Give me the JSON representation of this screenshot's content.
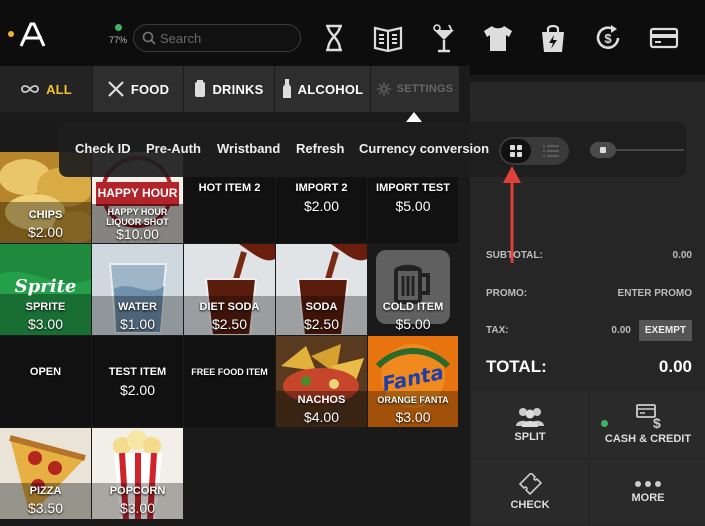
{
  "status": {
    "battery": "77%"
  },
  "search": {
    "placeholder": "Search"
  },
  "top_icons": [
    "hourglass-icon",
    "book-icon",
    "cocktail-icon",
    "tshirt-icon",
    "bag-icon",
    "dollar-refresh-icon",
    "card-icon"
  ],
  "categories": {
    "all": "ALL",
    "food": "FOOD",
    "drinks": "DRINKS",
    "alcohol": "ALCOHOL",
    "settings": "SETTINGS"
  },
  "popover": {
    "options": [
      "Check ID",
      "Pre-Auth",
      "Wristband",
      "Refresh",
      "Currency conversion"
    ]
  },
  "products": [
    {
      "name": "CHIPS",
      "price": "$2.00"
    },
    {
      "name": "HAPPY HOUR LIQUOR SHOT",
      "price": "$10.00",
      "logo_text": "HAPPY HOUR"
    },
    {
      "name": "HOT ITEM 2",
      "price": ""
    },
    {
      "name": "IMPORT 2",
      "price": "$2.00"
    },
    {
      "name": "IMPORT TEST",
      "price": "$5.00"
    },
    {
      "name": "SPRITE",
      "price": "$3.00",
      "logo_text": "Sprite"
    },
    {
      "name": "WATER",
      "price": "$1.00"
    },
    {
      "name": "DIET SODA",
      "price": "$2.50"
    },
    {
      "name": "SODA",
      "price": "$2.50"
    },
    {
      "name": "COLD ITEM",
      "price": "$5.00"
    },
    {
      "name": "OPEN",
      "price": ""
    },
    {
      "name": "TEST ITEM",
      "price": "$2.00"
    },
    {
      "name": "FREE FOOD ITEM",
      "price": ""
    },
    {
      "name": "NACHOS",
      "price": "$4.00"
    },
    {
      "name": "ORANGE FANTA",
      "price": "$3.00",
      "logo_text": "Fanta"
    },
    {
      "name": "PIZZA",
      "price": "$3.50"
    },
    {
      "name": "POPCORN",
      "price": "$3.00"
    }
  ],
  "summary": {
    "subtotal_label": "SUBTOTAL:",
    "subtotal_value": "0.00",
    "promo_label": "PROMO:",
    "promo_action": "ENTER PROMO",
    "tax_label": "TAX:",
    "tax_value": "0.00",
    "exempt_label": "EXEMPT",
    "total_label": "TOTAL:",
    "total_value": "0.00"
  },
  "actions": {
    "split": "SPLIT",
    "cash_credit": "CASH & CREDIT",
    "check": "CHECK",
    "more": "MORE"
  }
}
